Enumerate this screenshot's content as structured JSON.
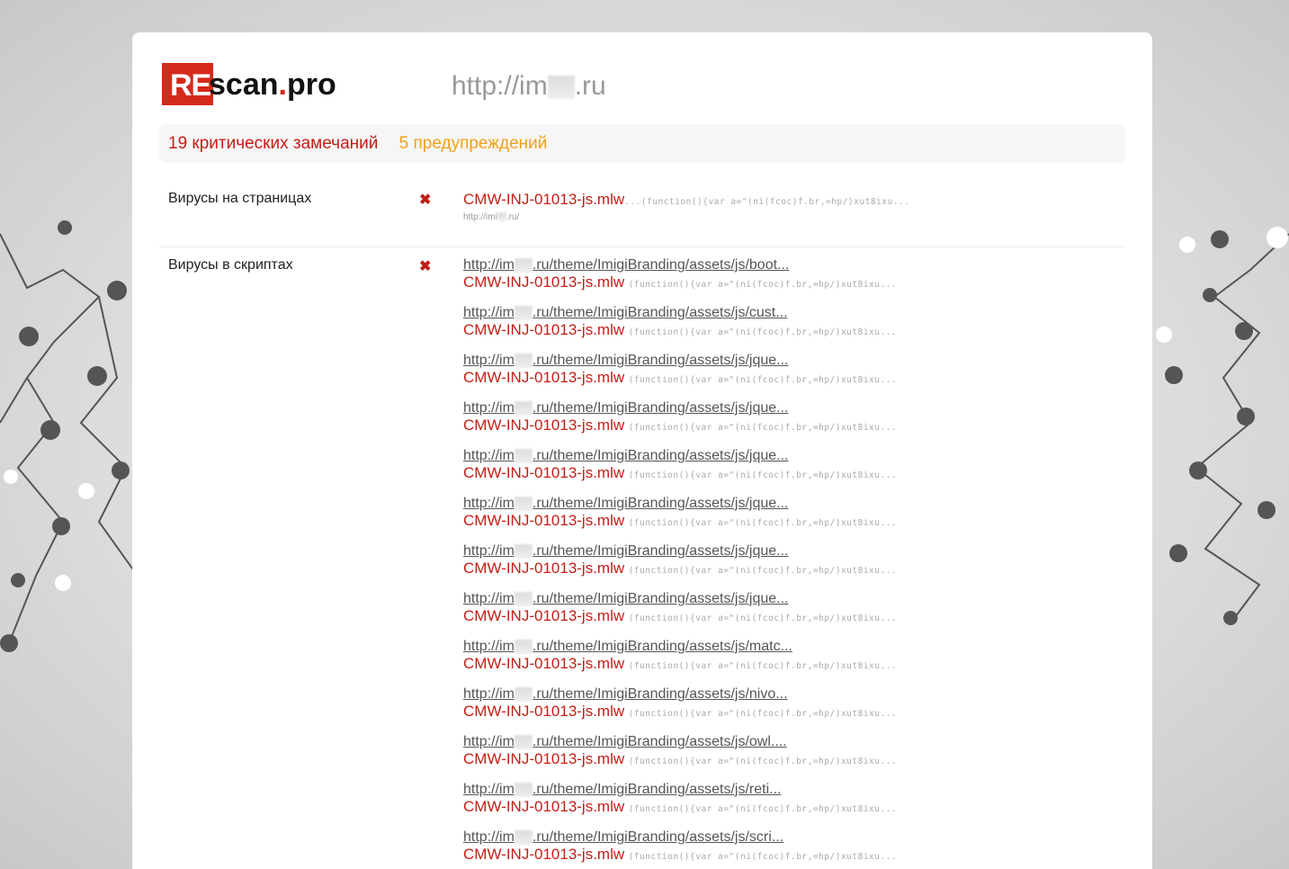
{
  "logo": {
    "re": "RE",
    "scan": "scan",
    "dot": ".",
    "pro": "pro"
  },
  "site": {
    "prefix": "http://im",
    "suffix": ".ru"
  },
  "summary": {
    "critical": "19 критических замечаний",
    "warnings": "5 предупреждений"
  },
  "sections": [
    {
      "title": "Вирусы на страницах",
      "signature": "CMW-INJ-01013-js.mlw",
      "snippet": "...(function(){var a=\"(ni(fcoc)f.br,=hp/)xut8ixu...",
      "url_prefix": "http://imi",
      "url_suffix": ".ru/"
    },
    {
      "title": "Вирусы в скриптах",
      "url_prefix": "http://im",
      "signature": "CMW-INJ-01013-js.mlw",
      "snippet": "(function(){var a=\"(ni(fcoc)f.br,=hp/)xut8ixu...",
      "entries": [
        ".ru/theme/ImigiBranding/assets/js/boot...",
        ".ru/theme/ImigiBranding/assets/js/cust...",
        ".ru/theme/ImigiBranding/assets/js/jque...",
        ".ru/theme/ImigiBranding/assets/js/jque...",
        ".ru/theme/ImigiBranding/assets/js/jque...",
        ".ru/theme/ImigiBranding/assets/js/jque...",
        ".ru/theme/ImigiBranding/assets/js/jque...",
        ".ru/theme/ImigiBranding/assets/js/jque...",
        ".ru/theme/ImigiBranding/assets/js/matc...",
        ".ru/theme/ImigiBranding/assets/js/nivo...",
        ".ru/theme/ImigiBranding/assets/js/owl....",
        ".ru/theme/ImigiBranding/assets/js/reti...",
        ".ru/theme/ImigiBranding/assets/js/scri..."
      ]
    }
  ]
}
